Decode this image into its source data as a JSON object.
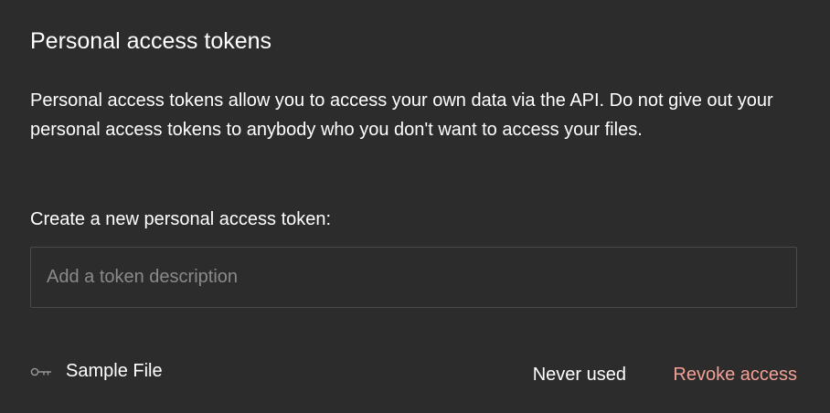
{
  "section": {
    "title": "Personal access tokens",
    "description": "Personal access tokens allow you to access your own data via the API. Do not give out your personal access tokens to anybody who you don't want to access your files."
  },
  "create": {
    "label": "Create a new personal access token:",
    "input_placeholder": "Add a token description",
    "input_value": ""
  },
  "tokens": [
    {
      "icon": "key-icon",
      "name": "Sample File",
      "status": "Never used",
      "action_label": "Revoke access"
    }
  ],
  "colors": {
    "background": "#2c2c2c",
    "text": "#ffffff",
    "placeholder": "#8a8a8a",
    "input_border": "#4a4a4a",
    "revoke_link": "#f2a196"
  }
}
